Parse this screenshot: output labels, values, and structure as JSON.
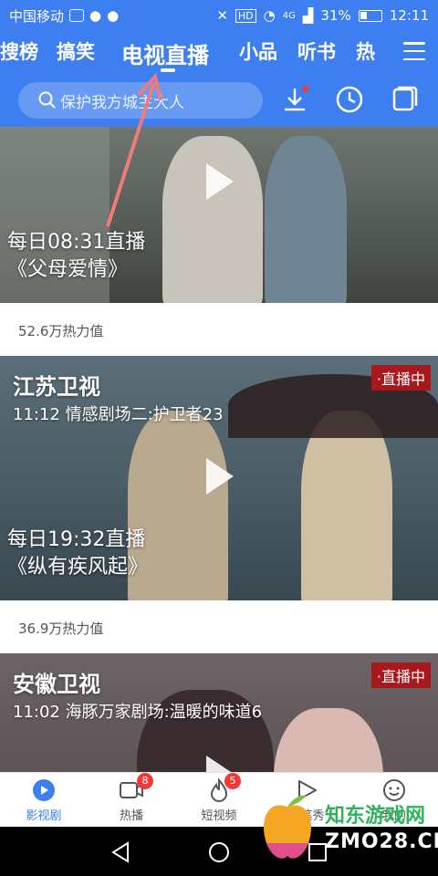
{
  "statusbar": {
    "carrier": "中国移动",
    "battery": "31%",
    "time": "12:11",
    "signal": "4G"
  },
  "header": {
    "tabs": [
      {
        "label": "搜榜"
      },
      {
        "label": "搞笑"
      },
      {
        "label": "电视直播",
        "active": true
      },
      {
        "label": "小品"
      },
      {
        "label": "听书"
      },
      {
        "label": "热"
      }
    ],
    "search_placeholder": "保护我方城主大人"
  },
  "feed": {
    "cards": [
      {
        "overlay_time": "每日08:31直播",
        "overlay_title": "《父母爱情》",
        "heat": "52.6万热力值"
      },
      {
        "channel": "江苏卫视",
        "program": "11:12 情感剧场二:护卫者23",
        "live": "·直播中",
        "overlay_time": "每日19:32直播",
        "overlay_title": "《纵有疾风起》",
        "heat": "36.9万热力值"
      },
      {
        "channel": "安徽卫视",
        "program": "11:02 海豚万家剧场:温暖的味道6",
        "live": "·直播中"
      }
    ]
  },
  "bottom_nav": [
    {
      "label": "影视剧",
      "icon": "play-circle-icon",
      "active": true
    },
    {
      "label": "热播",
      "icon": "video-camera-icon",
      "badge": "8"
    },
    {
      "label": "短视频",
      "icon": "flame-icon",
      "badge": "5"
    },
    {
      "label": "随笔秀",
      "icon": "play-triangle-icon"
    },
    {
      "label": "我的",
      "icon": "smile-icon"
    }
  ],
  "watermark": {
    "site_cn": "知东游戏网",
    "site_en": "ZMO28.CN"
  },
  "colors": {
    "brand": "#3d7ef0",
    "live": "#a8191e",
    "badge": "#f03a3a"
  }
}
